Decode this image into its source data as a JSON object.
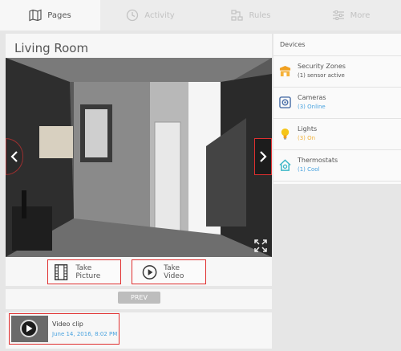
{
  "nav": {
    "tabs": [
      {
        "label": "Pages",
        "icon": "map-icon",
        "active": true
      },
      {
        "label": "Activity",
        "icon": "clock-icon",
        "active": false
      },
      {
        "label": "Rules",
        "icon": "rules-icon",
        "active": false
      },
      {
        "label": "More",
        "icon": "sliders-icon",
        "active": false
      }
    ]
  },
  "main": {
    "title": "Living Room",
    "take_picture_label": "Take Picture",
    "take_video_label": "Take Video",
    "prev_label": "PREV",
    "clip": {
      "title": "Video clip",
      "date": "June 14, 2016, 8:02 PM"
    }
  },
  "devices": {
    "header": "Devices",
    "items": [
      {
        "name": "Security Zones",
        "status": "(1) sensor active",
        "status_color": "#555555",
        "icon": "security-icon",
        "icon_color": "#f0a020"
      },
      {
        "name": "Cameras",
        "status": "(3) Online",
        "status_color": "#4aa3df",
        "icon": "camera-icon",
        "icon_color": "#4a6fa8"
      },
      {
        "name": "Lights",
        "status": "(3) On",
        "status_color": "#f2b33d",
        "icon": "bulb-icon",
        "icon_color": "#f5c518"
      },
      {
        "name": "Thermostats",
        "status": "(1) Cool",
        "status_color": "#4aa3df",
        "icon": "thermostat-house-icon",
        "icon_color": "#3fb8c8"
      }
    ]
  },
  "colors": {
    "accent_blue": "#4aa3df",
    "highlight_red": "#e03030"
  }
}
